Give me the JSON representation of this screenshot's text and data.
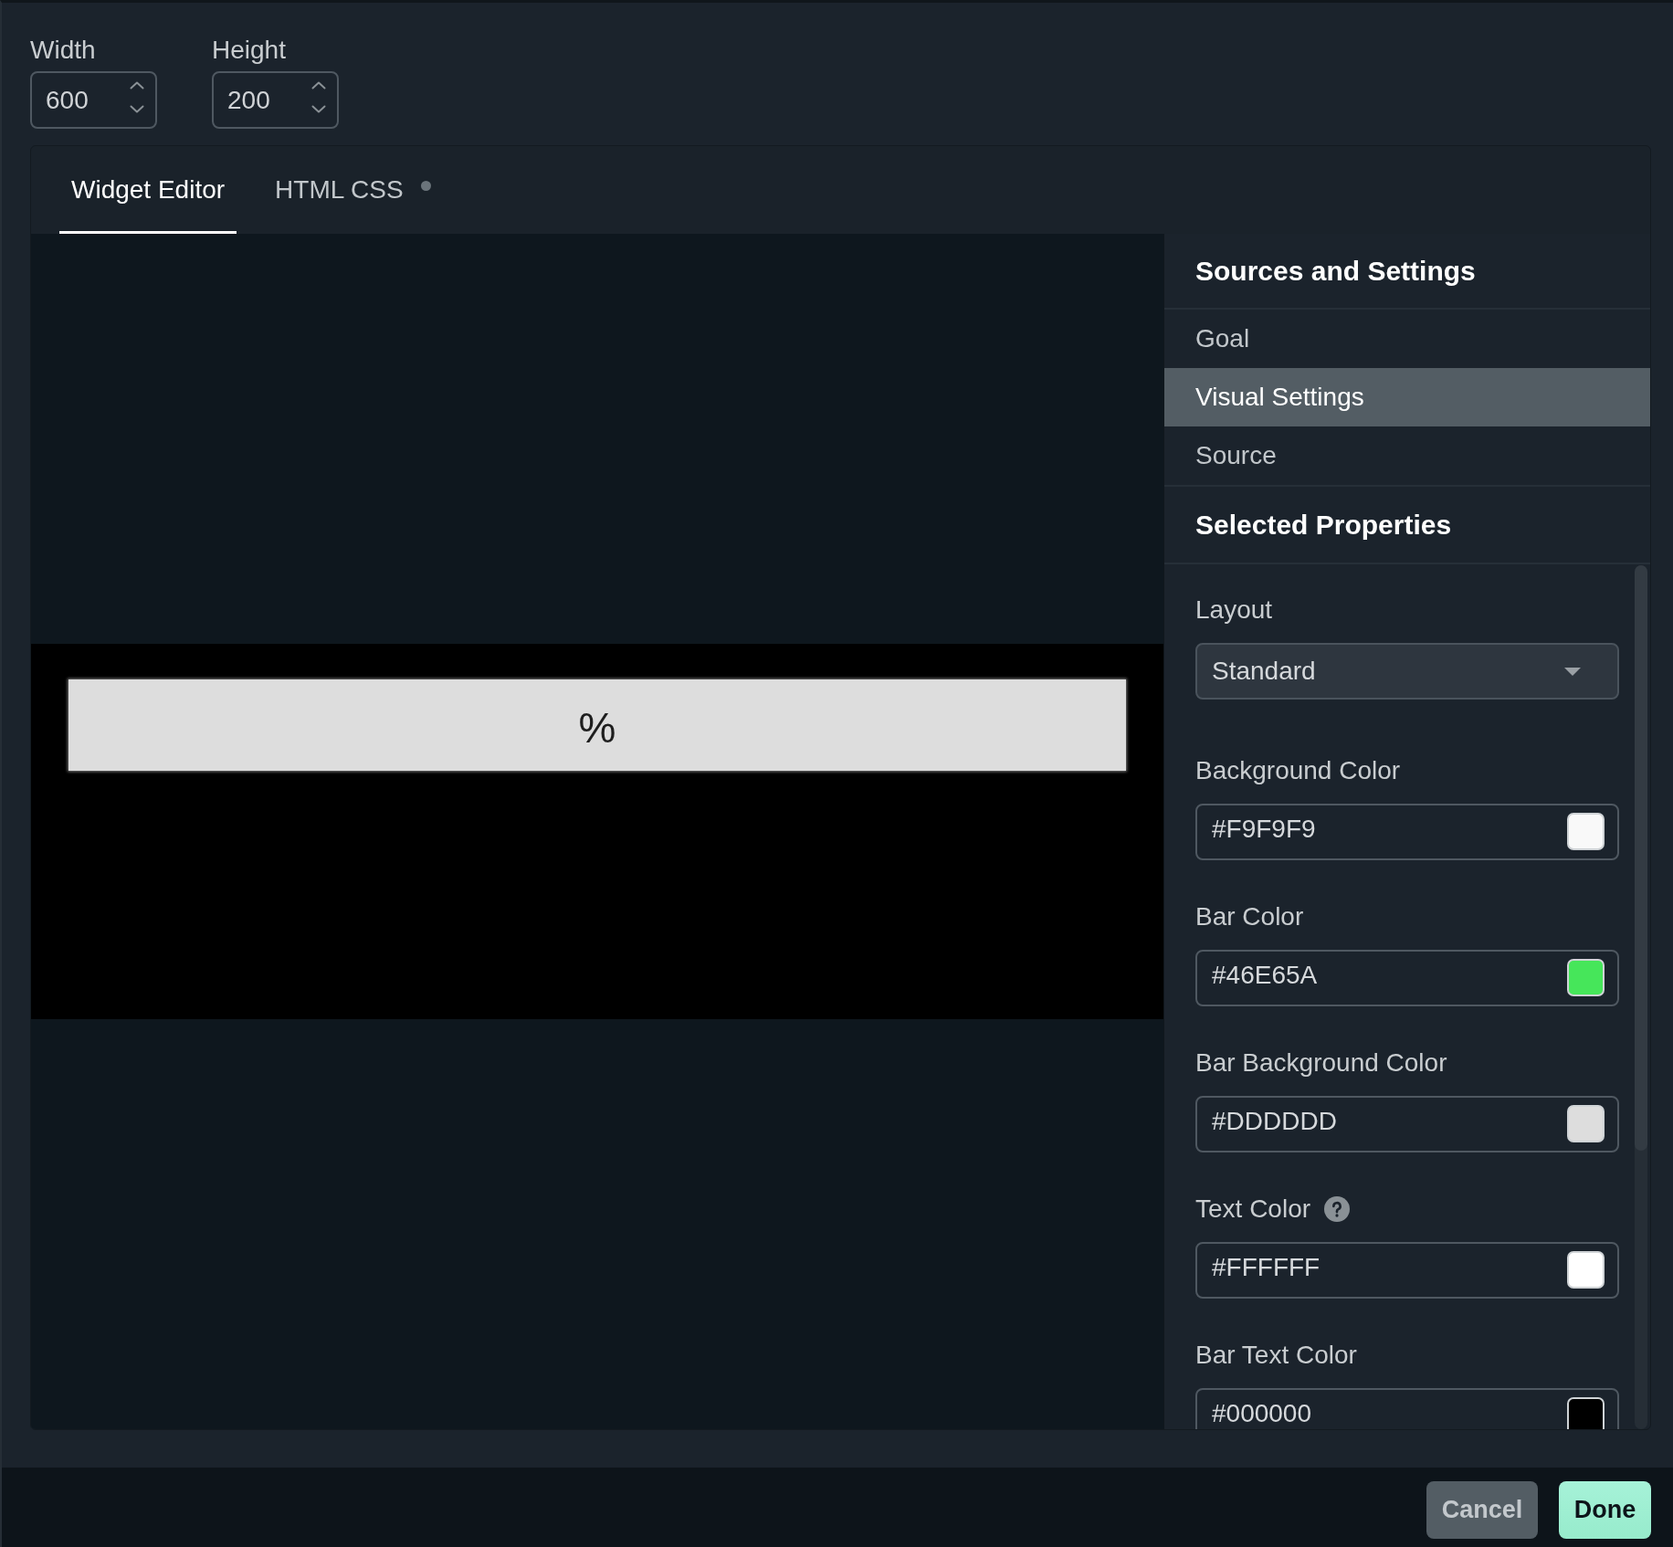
{
  "size_fields": [
    {
      "label": "Width",
      "value": "600"
    },
    {
      "label": "Height",
      "value": "200"
    }
  ],
  "tabs": [
    {
      "label": "Widget Editor",
      "selected": true,
      "dot": false
    },
    {
      "label": "HTML CSS",
      "selected": false,
      "dot": true
    }
  ],
  "preview": {
    "text": "%",
    "level": 0
  },
  "settings_nav": {
    "heading": "Sources and Settings",
    "items": [
      {
        "label": "Goal",
        "selected": false
      },
      {
        "label": "Visual Settings",
        "selected": true
      },
      {
        "label": "Source",
        "selected": false
      }
    ]
  },
  "properties": {
    "heading": "Selected Properties",
    "fields": [
      {
        "kind": "select",
        "label": "Layout",
        "value": "Standard",
        "help": false
      },
      {
        "kind": "color",
        "label": "Background Color",
        "value": "#F9F9F9",
        "color": "#f9f9f9",
        "help": false
      },
      {
        "kind": "color",
        "label": "Bar Color",
        "value": "#46E65A",
        "color": "#46e65a",
        "help": false
      },
      {
        "kind": "color",
        "label": "Bar Background Color",
        "value": "#DDDDDD",
        "color": "#dddddd",
        "help": false
      },
      {
        "kind": "color",
        "label": "Text Color",
        "value": "#FFFFFF",
        "color": "#ffffff",
        "help": true
      },
      {
        "kind": "color",
        "label": "Bar Text Color",
        "value": "#000000",
        "color": "#000000",
        "help": false
      }
    ]
  },
  "buttons": [
    {
      "label": "Cancel",
      "kind": "secondary"
    },
    {
      "label": "Done",
      "kind": "primary"
    }
  ]
}
